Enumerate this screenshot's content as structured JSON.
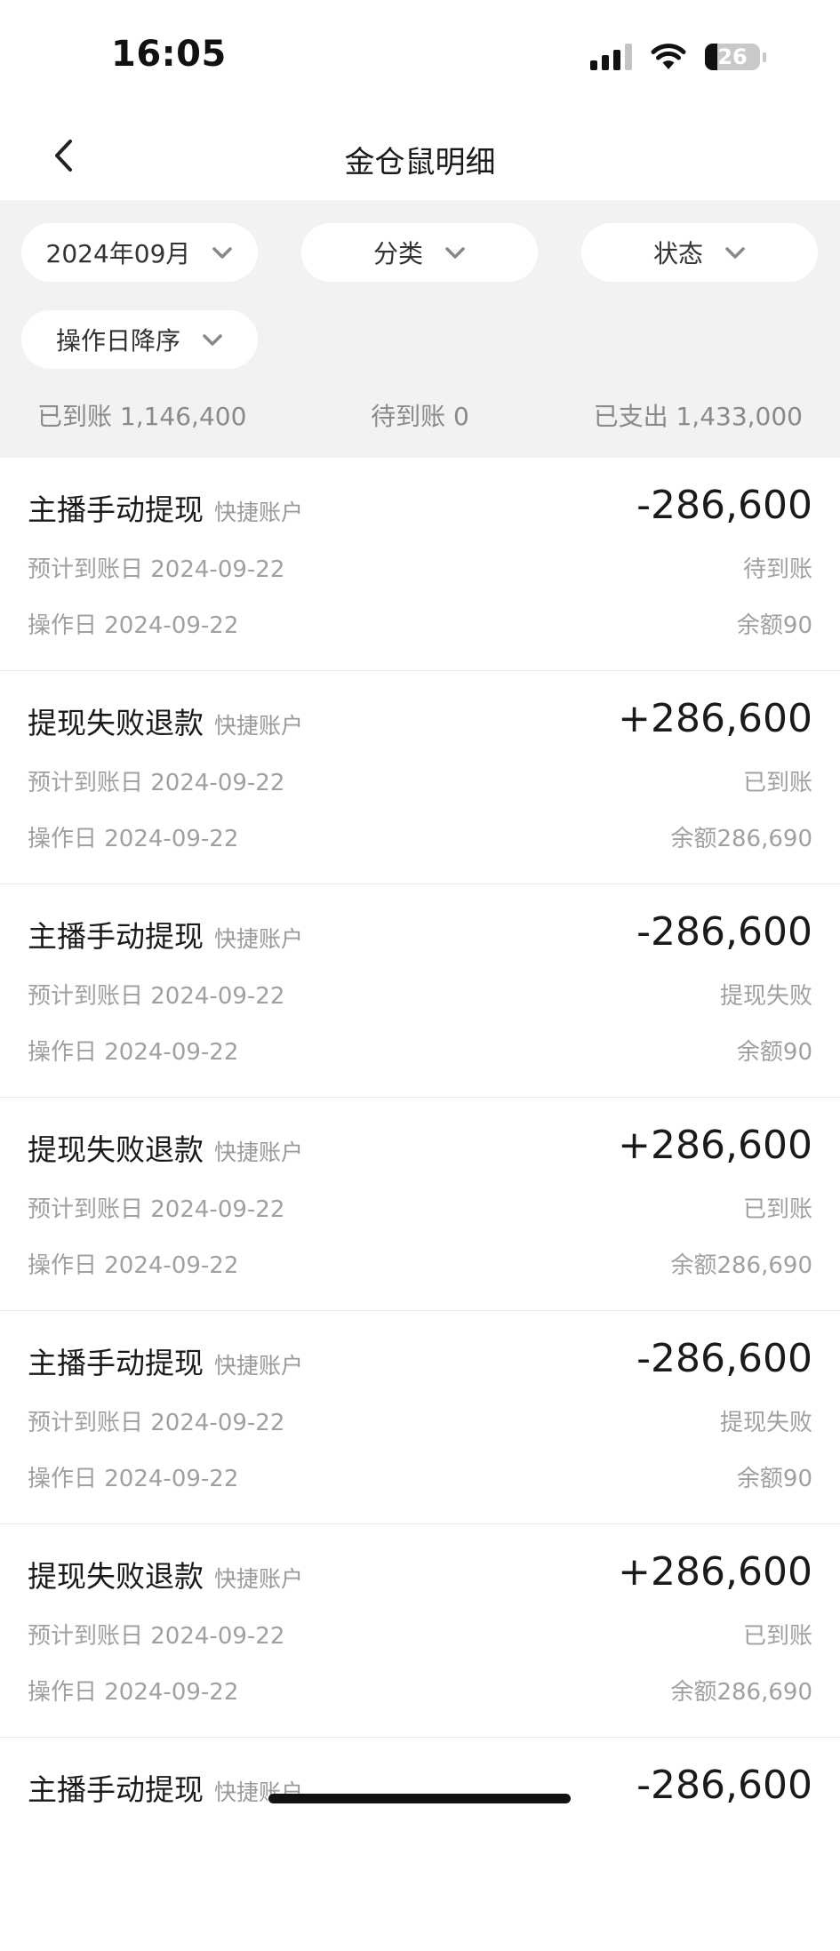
{
  "status_bar": {
    "time": "16:05",
    "battery_level": "26",
    "signal_icon": "cellular-signal-icon",
    "wifi_icon": "wifi-icon"
  },
  "nav": {
    "back_icon": "chevron-left-icon",
    "title": "金仓鼠明细"
  },
  "filters": {
    "month": "2024年09月",
    "category": "分类",
    "status": "状态",
    "sort": "操作日降序",
    "chevron_icon": "chevron-down-icon"
  },
  "summary": {
    "received": "已到账 1,146,400",
    "pending": "待到账 0",
    "spent": "已支出 1,433,000"
  },
  "rows": [
    {
      "name": "主播手动提现",
      "account": "快捷账户",
      "amount": "-286,600",
      "expected": "预计到账日 2024-09-22",
      "status": "待到账",
      "opdate": "操作日 2024-09-22",
      "balance": "余额90"
    },
    {
      "name": "提现失败退款",
      "account": "快捷账户",
      "amount": "+286,600",
      "expected": "预计到账日 2024-09-22",
      "status": "已到账",
      "opdate": "操作日 2024-09-22",
      "balance": "余额286,690"
    },
    {
      "name": "主播手动提现",
      "account": "快捷账户",
      "amount": "-286,600",
      "expected": "预计到账日 2024-09-22",
      "status": "提现失败",
      "opdate": "操作日 2024-09-22",
      "balance": "余额90"
    },
    {
      "name": "提现失败退款",
      "account": "快捷账户",
      "amount": "+286,600",
      "expected": "预计到账日 2024-09-22",
      "status": "已到账",
      "opdate": "操作日 2024-09-22",
      "balance": "余额286,690"
    },
    {
      "name": "主播手动提现",
      "account": "快捷账户",
      "amount": "-286,600",
      "expected": "预计到账日 2024-09-22",
      "status": "提现失败",
      "opdate": "操作日 2024-09-22",
      "balance": "余额90"
    },
    {
      "name": "提现失败退款",
      "account": "快捷账户",
      "amount": "+286,600",
      "expected": "预计到账日 2024-09-22",
      "status": "已到账",
      "opdate": "操作日 2024-09-22",
      "balance": "余额286,690"
    },
    {
      "name": "主播手动提现",
      "account": "快捷账户",
      "amount": "-286,600"
    }
  ]
}
